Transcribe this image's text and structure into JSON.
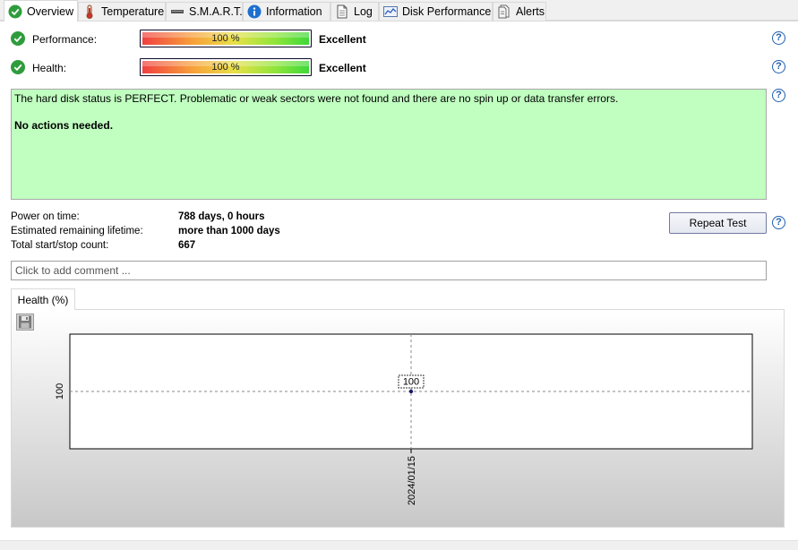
{
  "tabs": [
    {
      "label": "Overview",
      "icon": "check-circle-icon",
      "active": true
    },
    {
      "label": "Temperature",
      "icon": "thermometer-icon"
    },
    {
      "label": "S.M.A.R.T.",
      "icon": "smart-drive-icon"
    },
    {
      "label": "Information",
      "icon": "info-icon"
    },
    {
      "label": "Log",
      "icon": "document-icon"
    },
    {
      "label": "Disk Performance",
      "icon": "performance-chart-icon"
    },
    {
      "label": "Alerts",
      "icon": "alerts-document-icon"
    }
  ],
  "performance": {
    "label": "Performance:",
    "bar_text": "100 %",
    "value": 100,
    "rating": "Excellent"
  },
  "health": {
    "label": "Health:",
    "bar_text": "100 %",
    "value": 100,
    "rating": "Excellent"
  },
  "status": {
    "message": "The hard disk status is PERFECT. Problematic or weak sectors were not found and there are no spin up or data transfer errors.",
    "action": "No actions needed."
  },
  "stats": {
    "power_on_label": "Power on time:",
    "power_on_value": "788 days, 0 hours",
    "lifetime_label": "Estimated remaining lifetime:",
    "lifetime_value": "more than 1000 days",
    "startstop_label": "Total start/stop count:",
    "startstop_value": "667"
  },
  "repeat_test_label": "Repeat Test",
  "comment_placeholder": "Click to add comment ...",
  "help_glyph": "?",
  "chart_tab_label": "Health (%)",
  "colors": {
    "status_bg": "#c0ffc0",
    "ok_green": "#2e9c3d",
    "help_blue": "#1f5fb0",
    "data_point": "#1a1a6e"
  },
  "chart_data": {
    "type": "scatter",
    "x": [
      "2024/01/15"
    ],
    "series": [
      {
        "values": [
          100
        ]
      }
    ],
    "ytick_labels": [
      "100"
    ],
    "xtick_labels": [
      "2024/01/15"
    ],
    "data_labels": [
      "100"
    ],
    "grid": true
  }
}
